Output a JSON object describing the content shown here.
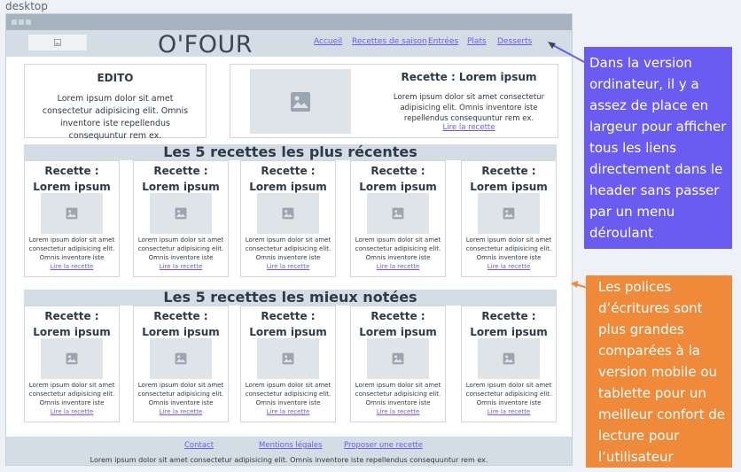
{
  "frame_label": "desktop",
  "header": {
    "brand": "O'FOUR",
    "nav": [
      "Accueil",
      "Recettes de saison",
      "Entrées",
      "Plats",
      "Desserts"
    ]
  },
  "edito": {
    "title": "EDITO",
    "text": "Lorem ipsum dolor sit amet consectetur adipisicing elit. Omnis inventore iste repellendus consequuntur rem ex."
  },
  "featured": {
    "title": "Recette : Lorem ipsum",
    "text": "Lorem ipsum dolor sit amet consectetur adipisicing elit. Omnis inventore iste repellendus consequuntur rem ex.",
    "link": "Lire la recette"
  },
  "recent": {
    "heading": "Les 5 recettes les plus récentes",
    "cards": [
      {
        "title": "Recette : Lorem ipsum",
        "text": "Lorem ipsum dolor sit amet consectetur adipisicing elit. Omnis inventore iste",
        "link": "Lire la recette"
      },
      {
        "title": "Recette : Lorem ipsum",
        "text": "Lorem ipsum dolor sit amet consectetur adipisicing elit. Omnis inventore iste",
        "link": "Lire la recette"
      },
      {
        "title": "Recette : Lorem ipsum",
        "text": "Lorem ipsum dolor sit amet consectetur adipisicing elit. Omnis inventore iste",
        "link": "Lire la recette"
      },
      {
        "title": "Recette : Lorem ipsum",
        "text": "Lorem ipsum dolor sit amet consectetur adipisicing elit. Omnis inventore iste",
        "link": "Lire la recette"
      },
      {
        "title": "Recette : Lorem ipsum",
        "text": "Lorem ipsum dolor sit amet consectetur adipisicing elit. Omnis inventore iste",
        "link": "Lire la recette"
      }
    ]
  },
  "top_rated": {
    "heading": "Les 5 recettes les mieux notées",
    "cards": [
      {
        "title": "Recette : Lorem ipsum",
        "text": "Lorem ipsum dolor sit amet consectetur adipisicing elit. Omnis inventore iste",
        "link": "Lire la recette"
      },
      {
        "title": "Recette : Lorem ipsum",
        "text": "Lorem ipsum dolor sit amet consectetur adipisicing elit. Omnis inventore iste",
        "link": "Lire la recette"
      },
      {
        "title": "Recette : Lorem ipsum",
        "text": "Lorem ipsum dolor sit amet consectetur adipisicing elit. Omnis inventore iste",
        "link": "Lire la recette"
      },
      {
        "title": "Recette : Lorem ipsum",
        "text": "Lorem ipsum dolor sit amet consectetur adipisicing elit. Omnis inventore iste",
        "link": "Lire la recette"
      },
      {
        "title": "Recette : Lorem ipsum",
        "text": "Lorem ipsum dolor sit amet consectetur adipisicing elit. Omnis inventore iste",
        "link": "Lire la recette"
      }
    ]
  },
  "footer": {
    "links": [
      "Contact",
      "Mentions légales",
      "Proposer une recette"
    ],
    "text": "Lorem ipsum dolor sit amet consectetur adipisicing elit. Omnis inventore iste repellendus consequuntur rem ex."
  },
  "notes": {
    "blue": "Dans la version ordinateur, il y a assez de place en largeur pour afficher tous les liens directement dans le header sans passer par un menu déroulant",
    "orange": "Les polices d’écritures sont plus grandes comparées à la version mobile ou tablette pour un meilleur confort de lecture pour l’utilisateur"
  },
  "colors": {
    "accent_link": "#6a5cf0",
    "note_blue": "#6a5cf0",
    "note_orange": "#ee8a3a",
    "header_bg": "#d4dde5"
  },
  "icons": [
    "image-placeholder-icon",
    "window-dots-icon",
    "arrow-icon"
  ]
}
